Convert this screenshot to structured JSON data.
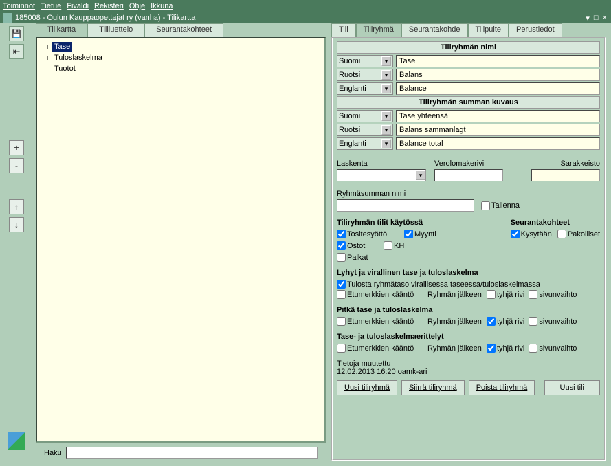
{
  "menu": {
    "items": [
      "Toiminnot",
      "Tietue",
      "Fivaldi",
      "Rekisteri",
      "Ohje",
      "Ikkuna"
    ]
  },
  "titlebar": {
    "text": "185008 - Oulun Kauppaopettajat ry (vanha) - Tilikartta"
  },
  "left_tools": {
    "save": "💾",
    "back": "⇤",
    "plus": "+",
    "minus": "-",
    "up": "↑",
    "down": "↓"
  },
  "center": {
    "tabs": [
      "Tilikartta",
      "Tililuettelo",
      "Seurantakohteet"
    ],
    "tree": [
      {
        "label": "Tase",
        "expand": "+",
        "selected": true
      },
      {
        "label": "Tuloslaskelma",
        "expand": "+",
        "selected": false
      },
      {
        "label": "Tuotot",
        "expand": "",
        "selected": false
      }
    ],
    "haku_label": "Haku"
  },
  "right": {
    "tabs": [
      "Tili",
      "Tiliryhmä",
      "Seurantakohde",
      "Tilipuite",
      "Perustiedot"
    ],
    "name_hdr": "Tiliryhmän nimi",
    "name_rows": [
      {
        "lang": "Suomi",
        "val": "Tase"
      },
      {
        "lang": "Ruotsi",
        "val": "Balans"
      },
      {
        "lang": "Englanti",
        "val": "Balance"
      }
    ],
    "sum_hdr": "Tiliryhmän summan kuvaus",
    "sum_rows": [
      {
        "lang": "Suomi",
        "val": "Tase yhteensä"
      },
      {
        "lang": "Ruotsi",
        "val": "Balans sammanlagt"
      },
      {
        "lang": "Englanti",
        "val": "Balance total"
      }
    ],
    "laskenta_lbl": "Laskenta",
    "verolomake_lbl": "Verolomakerivi",
    "sarakkeisto_lbl": "Sarakkeisto",
    "ryhmasum_lbl": "Ryhmäsumman nimi",
    "tallenna": "Tallenna",
    "tilit_hdr": "Tiliryhmän tilit käytössä",
    "tilit": [
      {
        "l": "Tositesyöttö",
        "c": true
      },
      {
        "l": "Myynti",
        "c": true
      },
      {
        "l": "Ostot",
        "c": true
      },
      {
        "l": "KH",
        "c": false
      },
      {
        "l": "Palkat",
        "c": false
      }
    ],
    "seur_hdr": "Seurantakohteet",
    "seur": [
      {
        "l": "Kysytään",
        "c": true
      },
      {
        "l": "Pakolliset",
        "c": false
      }
    ],
    "lyhyt_hdr": "Lyhyt ja virallinen tase ja tuloslaskelma",
    "tulosta": "Tulosta ryhmätaso virallisessa taseessa/tuloslaskelmassa",
    "etumerk": "Etumerkkien kääntö",
    "jalkeen": "Ryhmän jälkeen",
    "tyhja": "tyhjä rivi",
    "sivun": "sivunvaihto",
    "pitka_hdr": "Pitkä tase ja tuloslaskelma",
    "erittely_hdr": "Tase- ja tuloslaskelmaerittelyt",
    "tietoja": "Tietoja muutettu",
    "timestamp": "12.02.2013 16:20  oamk-ari",
    "btns": {
      "uusi_r": "Uusi tiliryhmä",
      "siirra": "Siirrä tiliryhmä",
      "poista": "Poista tiliryhmä",
      "uusi_t": "Uusi tili"
    }
  }
}
